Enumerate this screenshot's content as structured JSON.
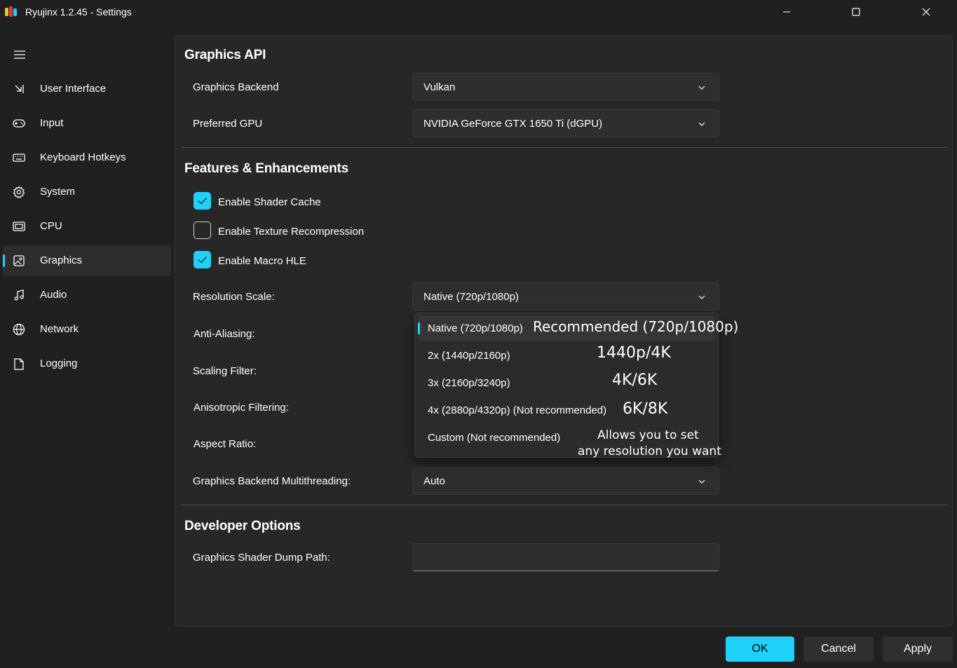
{
  "window": {
    "title": "Ryujinx 1.2.45 - Settings"
  },
  "sidebar": {
    "items": [
      {
        "label": "User Interface",
        "icon": "arrow-corner-icon"
      },
      {
        "label": "Input",
        "icon": "gamepad-icon"
      },
      {
        "label": "Keyboard Hotkeys",
        "icon": "keyboard-icon"
      },
      {
        "label": "System",
        "icon": "gear-icon"
      },
      {
        "label": "CPU",
        "icon": "chip-icon"
      },
      {
        "label": "Graphics",
        "icon": "image-icon",
        "selected": true
      },
      {
        "label": "Audio",
        "icon": "music-note-icon"
      },
      {
        "label": "Network",
        "icon": "globe-icon"
      },
      {
        "label": "Logging",
        "icon": "document-icon"
      }
    ]
  },
  "graphics_api": {
    "title": "Graphics API",
    "backend_label": "Graphics Backend",
    "backend_value": "Vulkan",
    "gpu_label": "Preferred GPU",
    "gpu_value": "NVIDIA GeForce GTX 1650 Ti (dGPU)"
  },
  "features": {
    "title": "Features & Enhancements",
    "shader_cache": {
      "label": "Enable Shader Cache",
      "checked": true
    },
    "texture_recompression": {
      "label": "Enable Texture Recompression",
      "checked": false
    },
    "macro_hle": {
      "label": "Enable Macro HLE",
      "checked": true
    },
    "resolution_label": "Resolution Scale:",
    "resolution_value": "Native (720p/1080p)",
    "anti_aliasing_label": "Anti-Aliasing:",
    "scaling_filter_label": "Scaling Filter:",
    "anisotropic_label": "Anisotropic Filtering:",
    "aspect_ratio_label": "Aspect Ratio:",
    "multithreading_label": "Graphics Backend Multithreading:",
    "multithreading_value": "Auto"
  },
  "resolution_dropdown": {
    "options": [
      {
        "label": "Native (720p/1080p)",
        "selected": true
      },
      {
        "label": "2x (1440p/2160p)"
      },
      {
        "label": "3x (2160p/3240p)"
      },
      {
        "label": "4x (2880p/4320p) (Not recommended)"
      },
      {
        "label": "Custom (Not recommended)"
      }
    ],
    "annotations": [
      "Recommended (720p/1080p)",
      "1440p/4K",
      "4K/6K",
      "6K/8K",
      "Allows you to set",
      "any resolution you want"
    ]
  },
  "developer": {
    "title": "Developer Options",
    "dump_path_label": "Graphics Shader Dump Path:",
    "dump_path_value": ""
  },
  "footer": {
    "ok": "OK",
    "cancel": "Cancel",
    "apply": "Apply"
  },
  "colors": {
    "accent": "#1fd1f9",
    "background": "#202020",
    "panel": "#272727"
  }
}
